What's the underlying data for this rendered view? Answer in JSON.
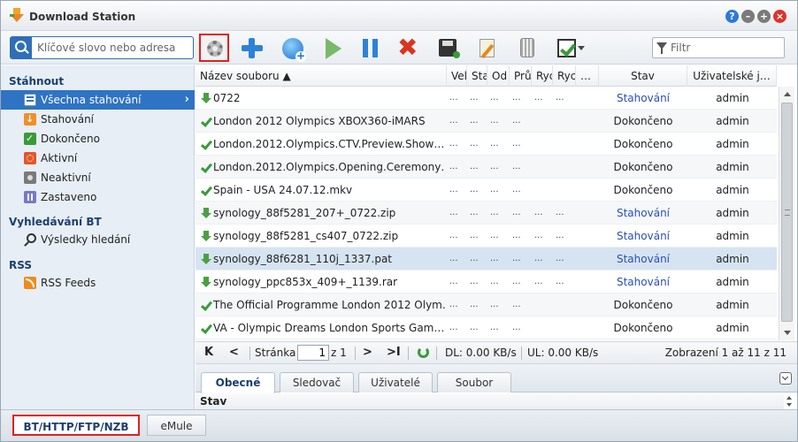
{
  "window": {
    "title": "Download Station",
    "help_label": "?",
    "min_label": "–",
    "max_label": "+",
    "close_label": "×"
  },
  "toolbar": {
    "search_placeholder": "Klíčové slovo nebo adresa",
    "filter_placeholder": "Filtr",
    "icons": [
      "gear-icon",
      "plus-icon",
      "add-url-icon",
      "play-icon",
      "pause-icon",
      "delete-icon",
      "save-icon",
      "edit-icon",
      "bin-icon",
      "select-icon"
    ]
  },
  "sidebar": {
    "sections": [
      {
        "title": "Stáhnout"
      },
      {
        "title": "Vyhledávání BT"
      },
      {
        "title": "RSS"
      }
    ],
    "items": [
      {
        "label": "Všechna stahování",
        "icon": "list-icon"
      },
      {
        "label": "Stahování",
        "icon": "download-icon"
      },
      {
        "label": "Dokončeno",
        "icon": "check-icon"
      },
      {
        "label": "Aktivní",
        "icon": "active-icon"
      },
      {
        "label": "Neaktivní",
        "icon": "inactive-icon"
      },
      {
        "label": "Zastaveno",
        "icon": "pause-icon"
      },
      {
        "label": "Výsledky hledání",
        "icon": "search-icon"
      },
      {
        "label": "RSS Feeds",
        "icon": "rss-icon"
      }
    ]
  },
  "grid": {
    "columns": [
      "Název souboru ▲",
      "Vel",
      "Sta",
      "Od",
      "Prů",
      "Ryc",
      "Ryc",
      "…",
      "Stav",
      "Uživatelské j…"
    ],
    "dots": "...",
    "rows": [
      {
        "name": "0722",
        "status": "Stahování",
        "user": "admin",
        "kind": "dl"
      },
      {
        "name": "London 2012 Olympics XBOX360-iMARS",
        "status": "Dokončeno",
        "user": "admin",
        "kind": "done"
      },
      {
        "name": "London.2012.Olympics.CTV.Preview.Show…",
        "status": "Dokončeno",
        "user": "admin",
        "kind": "done"
      },
      {
        "name": "London.2012.Olympics.Opening.Ceremony…",
        "status": "Dokončeno",
        "user": "admin",
        "kind": "done"
      },
      {
        "name": "Spain - USA 24.07.12.mkv",
        "status": "Dokončeno",
        "user": "admin",
        "kind": "done"
      },
      {
        "name": "synology_88f5281_207+_0722.zip",
        "status": "Stahování",
        "user": "admin",
        "kind": "dl"
      },
      {
        "name": "synology_88f5281_cs407_0722.zip",
        "status": "Stahování",
        "user": "admin",
        "kind": "dl"
      },
      {
        "name": "synology_88f6281_110j_1337.pat",
        "status": "Stahování",
        "user": "admin",
        "kind": "dl",
        "selected": true
      },
      {
        "name": "synology_ppc853x_409+_1139.rar",
        "status": "Stahování",
        "user": "admin",
        "kind": "dl"
      },
      {
        "name": "The Official Programme London 2012 Olym…",
        "status": "Dokončeno",
        "user": "admin",
        "kind": "done"
      },
      {
        "name": "VA - Olympic Dreams London Sports Gam…",
        "status": "Dokončeno",
        "user": "admin",
        "kind": "done"
      }
    ]
  },
  "pager": {
    "first": "K",
    "prev": "<",
    "page_label": "Stránka",
    "page_value": "1",
    "of_label": "z 1",
    "next": ">",
    "last": ">I",
    "dl_speed": "DL: 0.00 KB/s",
    "ul_speed": "UL: 0.00 KB/s",
    "summary": "Zobrazení 1 až 11 z 11"
  },
  "detail": {
    "tabs": [
      "Obecné",
      "Sledovač",
      "Uživatelé",
      "Soubor"
    ],
    "active_tab": "Obecné",
    "header": "Stav"
  },
  "bottom_tabs": {
    "active": "BT/HTTP/FTP/NZB",
    "inactive": "eMule"
  },
  "colors": {
    "accent": "#2f73c4",
    "highlight_border": "#e02020",
    "status_downloading": "#2a4fb5"
  }
}
